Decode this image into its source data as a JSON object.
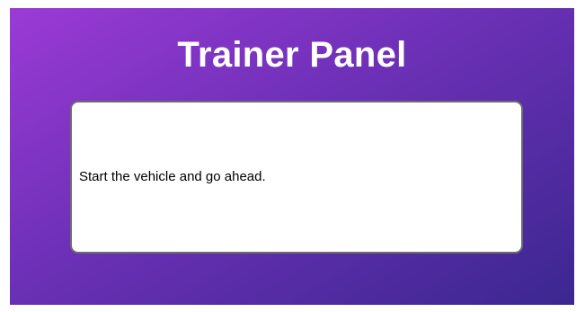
{
  "panel": {
    "title": "Trainer Panel",
    "message": "Start the vehicle and go ahead."
  },
  "colors": {
    "gradient_start": "#9b3ad6",
    "gradient_end": "#3b2790",
    "text_on_background": "#ffffff",
    "message_box_background": "#ffffff"
  }
}
